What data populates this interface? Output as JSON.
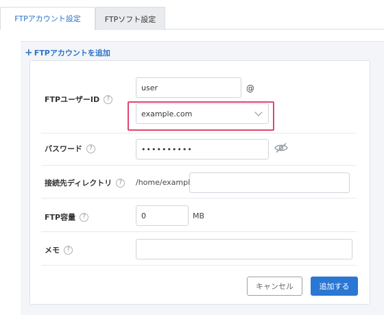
{
  "tabs": [
    {
      "label": "FTPアカウント設定",
      "active": true
    },
    {
      "label": "FTPソフト設定",
      "active": false
    }
  ],
  "add_account_label": "FTPアカウントを追加",
  "form": {
    "ftp_user_id_label": "FTPユーザーID",
    "user_value": "user",
    "at_sign": "@",
    "domain_value": "example.com",
    "password_label": "パスワード",
    "password_value": "••••••••••",
    "directory_label": "接続先ディレクトリ",
    "directory_prefix": "/home/example/",
    "directory_value": "",
    "capacity_label": "FTP容量",
    "capacity_value": "0",
    "capacity_unit": "MB",
    "memo_label": "メモ",
    "memo_value": "",
    "help_glyph": "?"
  },
  "buttons": {
    "cancel_label": "キャンセル",
    "submit_label": "追加する"
  },
  "colors": {
    "accent": "#2b73c8",
    "highlight": "#e0446d",
    "primary_button": "#2b77d4"
  }
}
